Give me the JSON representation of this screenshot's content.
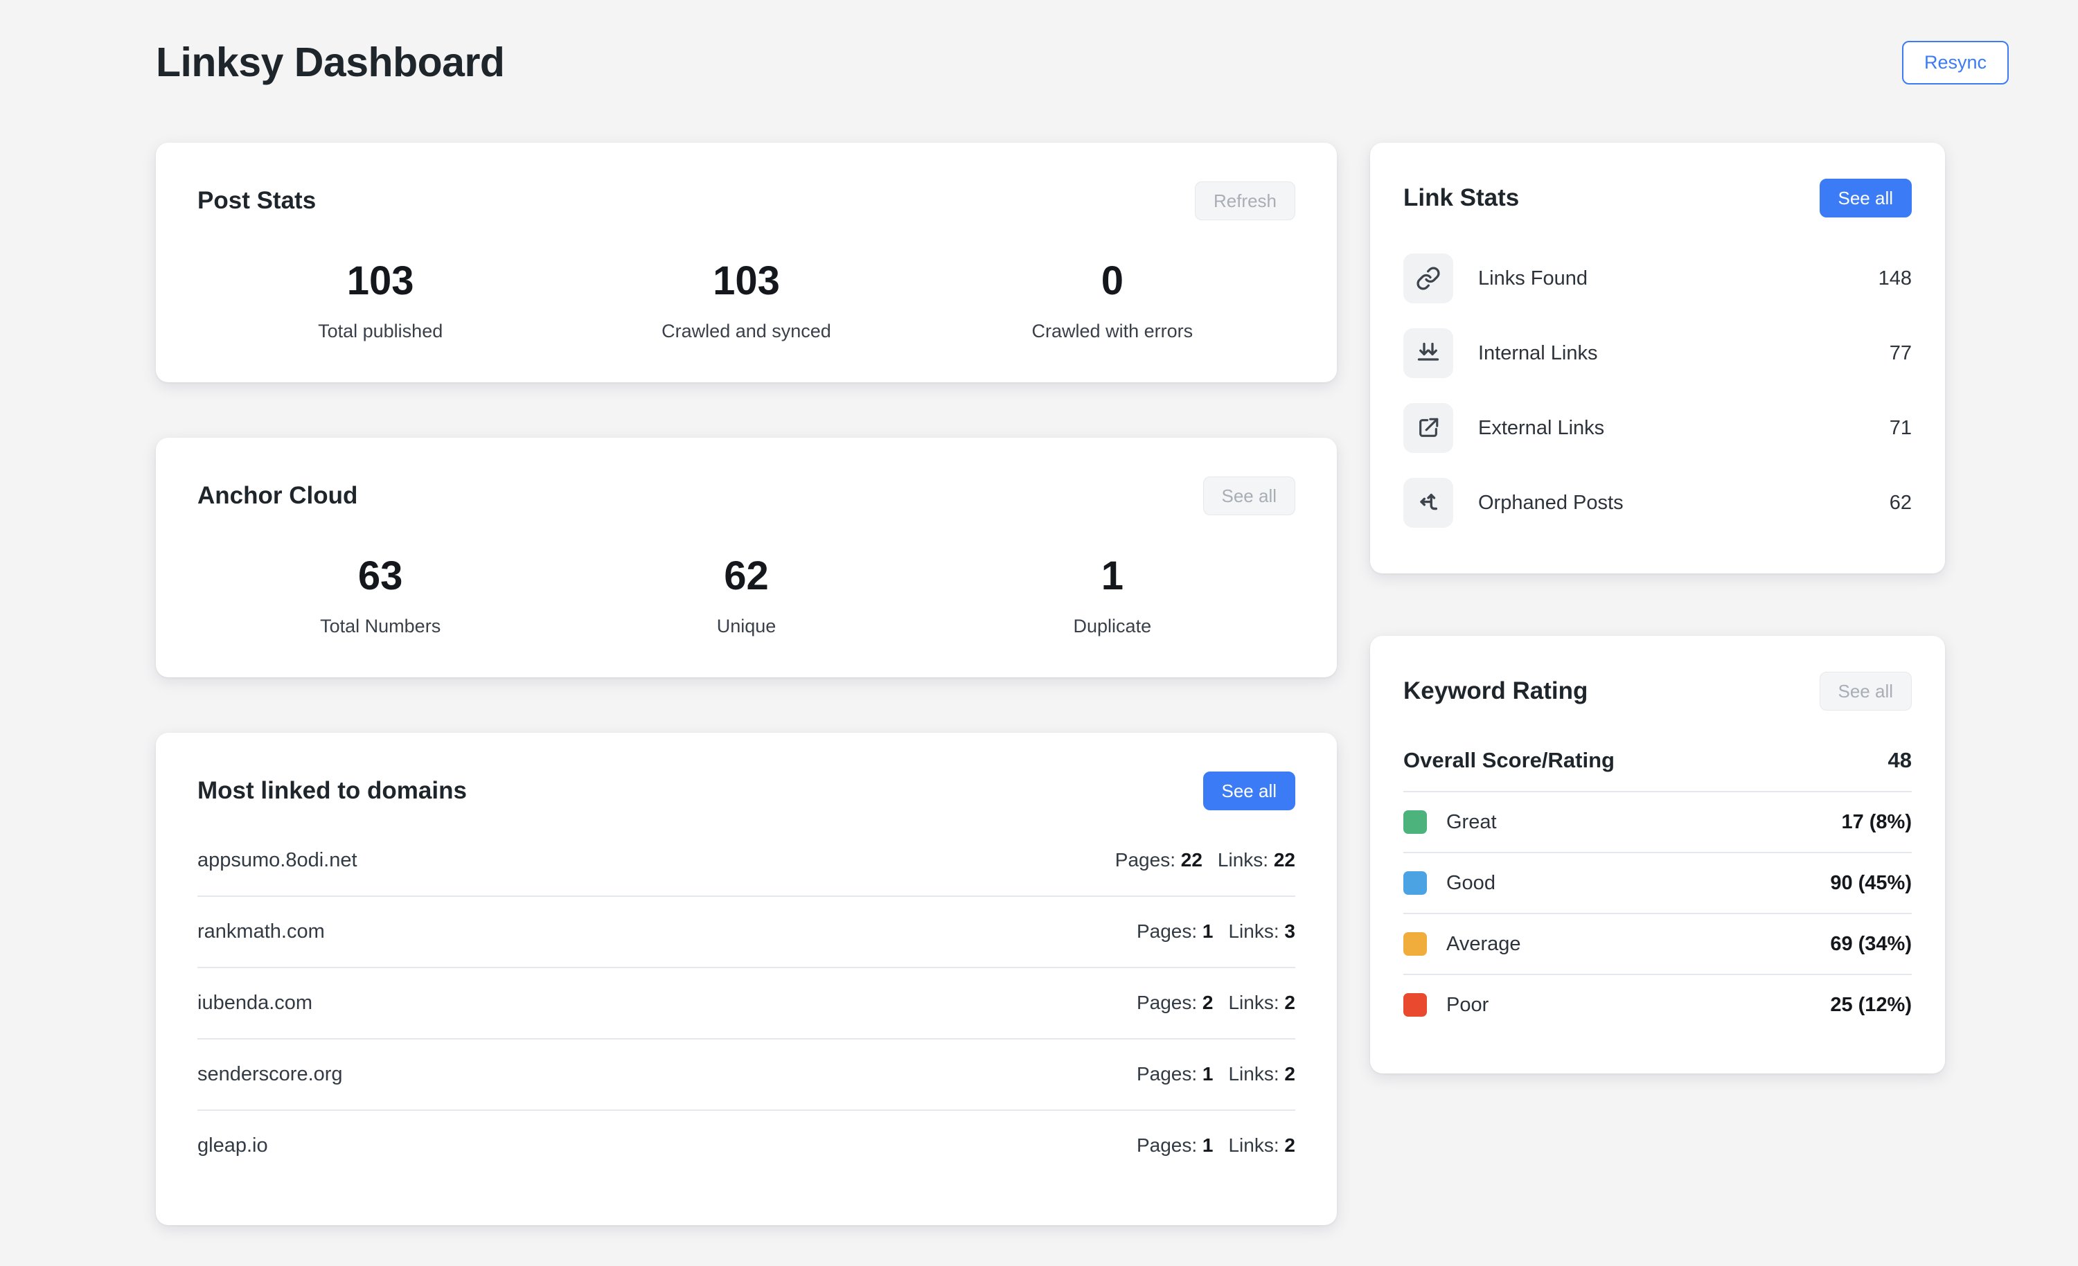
{
  "header": {
    "title": "Linksy Dashboard",
    "resync_label": "Resync"
  },
  "post_stats": {
    "title": "Post Stats",
    "action_label": "Refresh",
    "items": [
      {
        "value": "103",
        "label": "Total published"
      },
      {
        "value": "103",
        "label": "Crawled and synced"
      },
      {
        "value": "0",
        "label": "Crawled with errors"
      }
    ]
  },
  "anchor_cloud": {
    "title": "Anchor Cloud",
    "action_label": "See all",
    "items": [
      {
        "value": "63",
        "label": "Total Numbers"
      },
      {
        "value": "62",
        "label": "Unique"
      },
      {
        "value": "1",
        "label": "Duplicate"
      }
    ]
  },
  "domains": {
    "title": "Most linked to domains",
    "action_label": "See all",
    "pages_label": "Pages:",
    "links_label": "Links:",
    "rows": [
      {
        "name": "appsumo.8odi.net",
        "pages": "22",
        "links": "22"
      },
      {
        "name": "rankmath.com",
        "pages": "1",
        "links": "3"
      },
      {
        "name": "iubenda.com",
        "pages": "2",
        "links": "2"
      },
      {
        "name": "senderscore.org",
        "pages": "1",
        "links": "2"
      },
      {
        "name": "gleap.io",
        "pages": "1",
        "links": "2"
      }
    ]
  },
  "link_stats": {
    "title": "Link Stats",
    "action_label": "See all",
    "rows": [
      {
        "icon": "chain-link-icon",
        "label": "Links Found",
        "value": "148"
      },
      {
        "icon": "arrows-down-to-line-icon",
        "label": "Internal Links",
        "value": "77"
      },
      {
        "icon": "external-link-icon",
        "label": "External Links",
        "value": "71"
      },
      {
        "icon": "directions-fork-icon",
        "label": "Orphaned Posts",
        "value": "62"
      }
    ]
  },
  "keyword_rating": {
    "title": "Keyword Rating",
    "action_label": "See all",
    "overall_label": "Overall Score/Rating",
    "overall_value": "48",
    "rows": [
      {
        "label": "Great",
        "value": "17 (8%)",
        "color": "#4cb37c"
      },
      {
        "label": "Good",
        "value": "90 (45%)",
        "color": "#4ba3e3"
      },
      {
        "label": "Average",
        "value": "69 (34%)",
        "color": "#f0ad3c"
      },
      {
        "label": "Poor",
        "value": "25 (12%)",
        "color": "#e8492f"
      }
    ]
  },
  "colors": {
    "accent_blue": "#3b7cf6",
    "page_background": "#f4f4f5",
    "card_background": "#ffffff",
    "text_dark": "#1e252b",
    "disabled_text": "#a9aeb6"
  }
}
